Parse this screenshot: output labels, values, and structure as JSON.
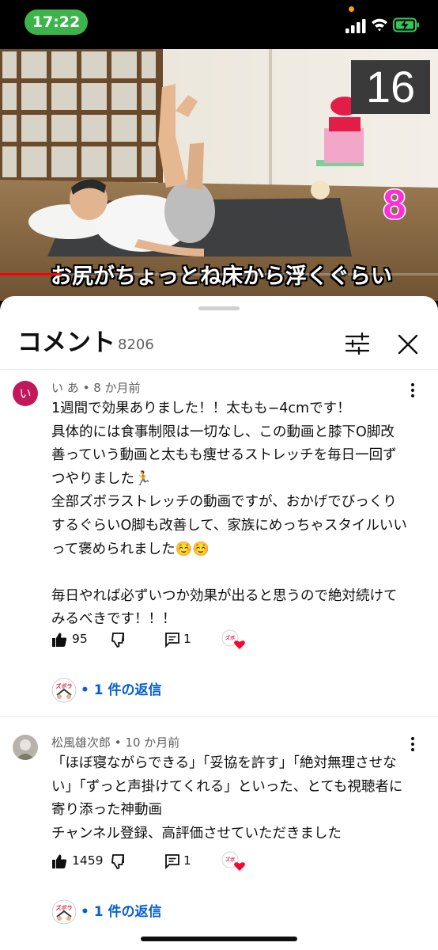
{
  "status_bar": {
    "time": "17:22"
  },
  "video": {
    "counter": "16",
    "rep_number": "8",
    "caption": "お尻がちょっとね床から浮くぐらい",
    "progress": 0.14
  },
  "comments_panel": {
    "title": "コメント",
    "count": "8206"
  },
  "comments": [
    {
      "avatar_letter": "い",
      "author": "い あ",
      "time": "8 か月前",
      "body": "1週間で効果ありました！！太もも−4cmです！\n具体的には食事制限は一切なし、この動画と膝下O脚改善っていう動画と太もも痩せるストレッチを毎日一回ずつやりました🏃\n全部ズボラストレッチの動画ですが、おかげでびっくりするぐらいO脚も改善して、家族にめっちゃスタイルいいって褒められました☺️☺️\n\n毎日やれば必ずいつか効果が出ると思うので絶対続けてみるべきです！！！",
      "likes": "95",
      "reply_count": "1",
      "replies_label": "• 1 件の返信"
    },
    {
      "author": "松風雄次郎",
      "time": "10 か月前",
      "body": "「ほぼ寝ながらできる」「妥協を許す」「絶対無理させない」「ずっと声掛けてくれる」といった、とても視聴者に寄り添った神動画\nチャンネル登録、高評価させていただきました",
      "likes": "1459",
      "reply_count": "1",
      "replies_label": "• 1 件の返信"
    }
  ],
  "creator_badge": "ズボラ",
  "colors": {
    "status_pill": "#3cb44b",
    "progress": "#ff0000",
    "link": "#065fd4",
    "rep_number": "#ff2fd6",
    "heart": "#ff0033"
  }
}
